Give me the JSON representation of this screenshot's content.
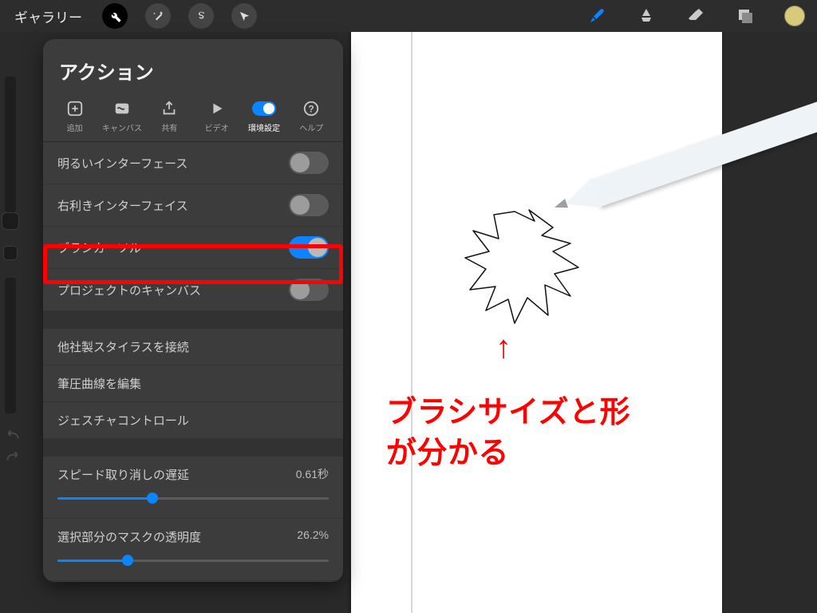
{
  "topbar": {
    "gallery": "ギャラリー",
    "left_icons": [
      "wrench-icon",
      "wand-icon",
      "s-icon",
      "arrow-icon"
    ]
  },
  "popover": {
    "title": "アクション",
    "tabs": [
      {
        "icon": "plus-box-icon",
        "label": "追加"
      },
      {
        "icon": "canvas-icon",
        "label": "キャンバス"
      },
      {
        "icon": "share-icon",
        "label": "共有"
      },
      {
        "icon": "play-icon",
        "label": "ビデオ"
      },
      {
        "icon": "toggle-icon",
        "label": "環境設定",
        "active": true
      },
      {
        "icon": "help-icon",
        "label": "ヘルプ"
      }
    ],
    "rows_toggle": [
      {
        "label": "明るいインターフェース",
        "on": false
      },
      {
        "label": "右利きインターフェイス",
        "on": false
      },
      {
        "label": "ブラシカーソル",
        "on": true
      },
      {
        "label": "プロジェクトのキャンバス",
        "on": false
      }
    ],
    "rows_plain": [
      "他社製スタイラスを接続",
      "筆圧曲線を編集",
      "ジェスチャコントロール"
    ],
    "rows_slider": [
      {
        "label": "スピード取り消しの遅延",
        "value": "0.61秒",
        "pct": 35
      },
      {
        "label": "選択部分のマスクの透明度",
        "value": "26.2%",
        "pct": 26
      }
    ]
  },
  "annotation": {
    "arrow": "↑",
    "caption": "ブラシサイズと形\nが分かる"
  }
}
